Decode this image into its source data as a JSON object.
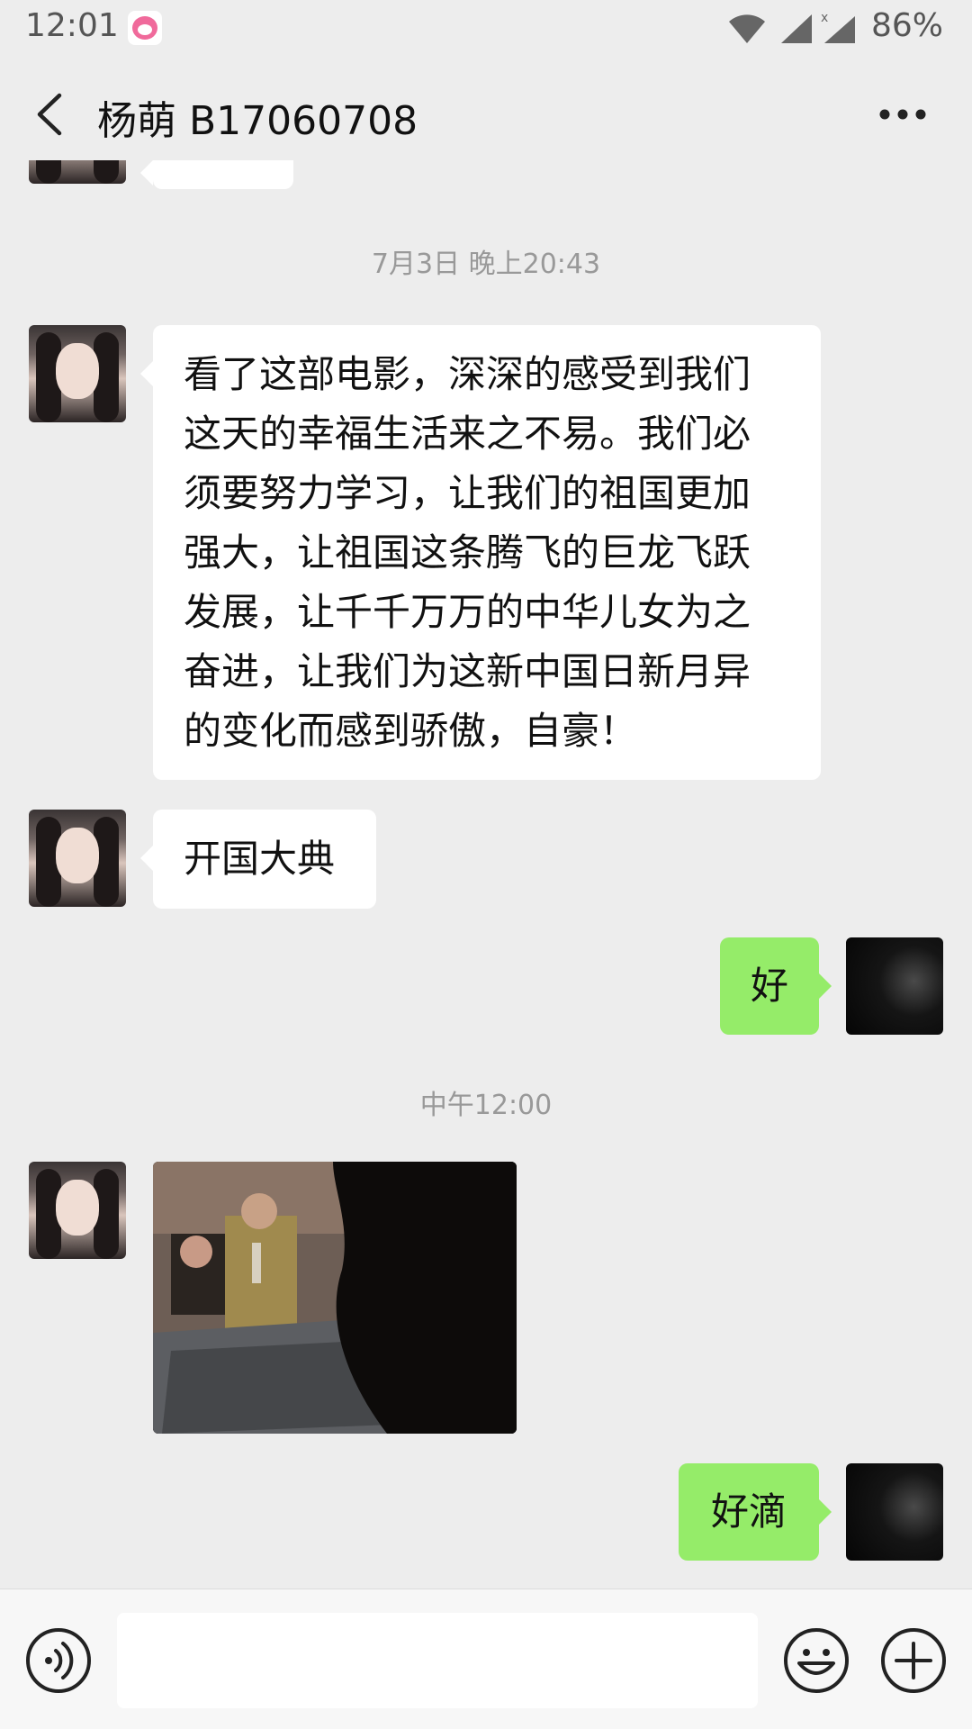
{
  "status_bar": {
    "time": "12:01",
    "battery": "86%"
  },
  "header": {
    "title": "杨萌 B17060708"
  },
  "messages": {
    "timestamp_1": "7月3日 晚上20:43",
    "msg_long": "看了这部电影，深深的感受到我们这天的幸福生活来之不易。我们必须要努力学习，让我们的祖国更加强大，让祖国这条腾飞的巨龙飞跃发展，让千千万万的中华儿女为之奋进，让我们为这新中国日新月异的变化而感到骄傲，自豪！",
    "msg_long_lines": [
      "看了这部电影，深深的感受到我们",
      "这天的幸福生活来之不易。我们必",
      "须要努力学习，让我们的祖国更加",
      "强大，让祖国这条腾飞的巨龙飞跃",
      "发展，让千千万万的中华儿女为之",
      "奋进，让我们为这新中国日新月异",
      "的变化而感到骄傲，自豪！"
    ],
    "msg_title": "开国大典",
    "reply_1": "好",
    "timestamp_2": "中午12:00",
    "reply_2": "好滴"
  },
  "colors": {
    "background": "#ededed",
    "outgoing_bubble": "#95ec69",
    "incoming_bubble": "#ffffff",
    "timestamp_text": "#999999"
  },
  "icons": {
    "back": "back-arrow-icon",
    "more": "more-dots-icon",
    "voice": "voice-icon",
    "emoji": "emoji-icon",
    "plus": "plus-icon"
  }
}
